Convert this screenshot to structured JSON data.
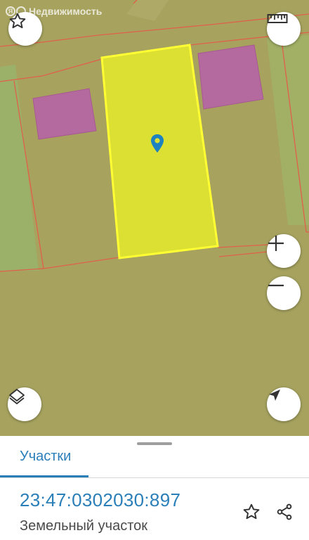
{
  "map": {
    "brand": {
      "logo_text": "Я",
      "label": "Недвижимость"
    },
    "colors": {
      "background": "#a7a35f",
      "selected_parcel_fill": "#dbe032",
      "selected_parcel_stroke": "#ffff33",
      "building_fill": "#b46a9e",
      "boundary_line": "#e0604a",
      "pin": "#1e82c0"
    },
    "controls": {
      "favorite": {
        "icon": "star-outline-icon"
      },
      "ruler": {
        "icon": "ruler-icon"
      },
      "zoom_in": {
        "icon": "plus-icon"
      },
      "zoom_out": {
        "icon": "minus-icon"
      },
      "layers": {
        "icon": "layers-icon"
      },
      "locate": {
        "icon": "navigation-arrow-icon"
      }
    }
  },
  "sheet": {
    "tab_label": "Участки",
    "cadastral_number": "23:47:0302030:897",
    "property_type": "Земельный участок",
    "actions": {
      "favorite_icon": "star-outline-icon",
      "share_icon": "share-icon"
    }
  }
}
